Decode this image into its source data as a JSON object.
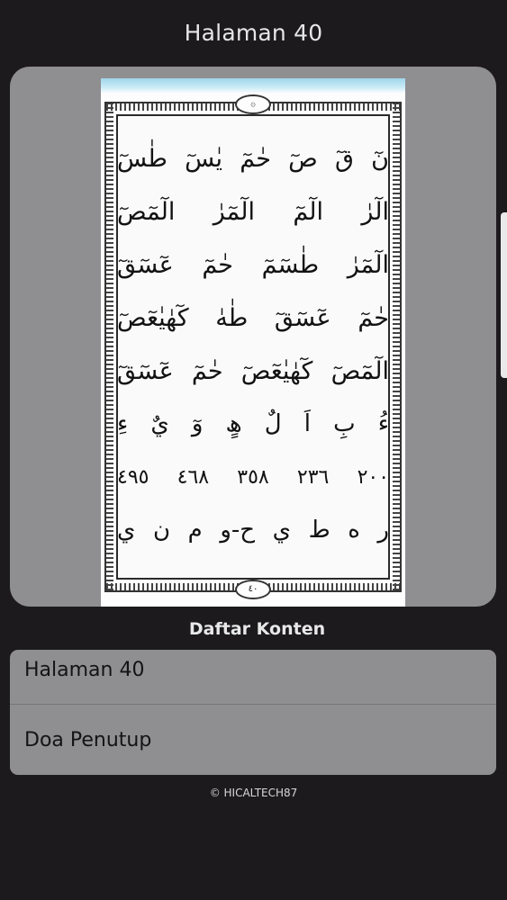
{
  "header": {
    "title": "Halaman 40"
  },
  "viewer": {
    "page_number": "٤٠",
    "lines": [
      "نٓ قٓ صٓ حٰمٓ يٰسٓ طٰسٓ",
      "الٓرٰ الٓمٓ الٓمٓرٰ الٓمٓصٓ",
      "الٓمٓرٰ طٰسٓمٓ حٰمٓ عٓسٓقٓ",
      "حٰمٓ عٓسٓقٓ طٰهٰ كٓهٰيٰعٓصٓ",
      "الٓمٓصٓ كٓهٰيٰعٓصٓ حٰمٓ عٓسٓقٓ",
      "ءُ بِ اَ لٌ ھٍ وٓ يٌ ءِ",
      "٢٠٠ ٢٣٦ ٣٥٨ ٤٦٨ ٤٩٥",
      "ر ه ط ي ح-و م ن ي"
    ]
  },
  "content_list": {
    "title": "Daftar Konten",
    "items": [
      {
        "label": "Halaman 40"
      },
      {
        "label": "Doa Penutup"
      }
    ]
  },
  "footer": {
    "copyright": "© HICALTECH87"
  },
  "colors": {
    "background": "#1c1a1d",
    "panel": "#8f8e90",
    "page": "#fdfdfd",
    "text_light": "#e6e6e6"
  }
}
